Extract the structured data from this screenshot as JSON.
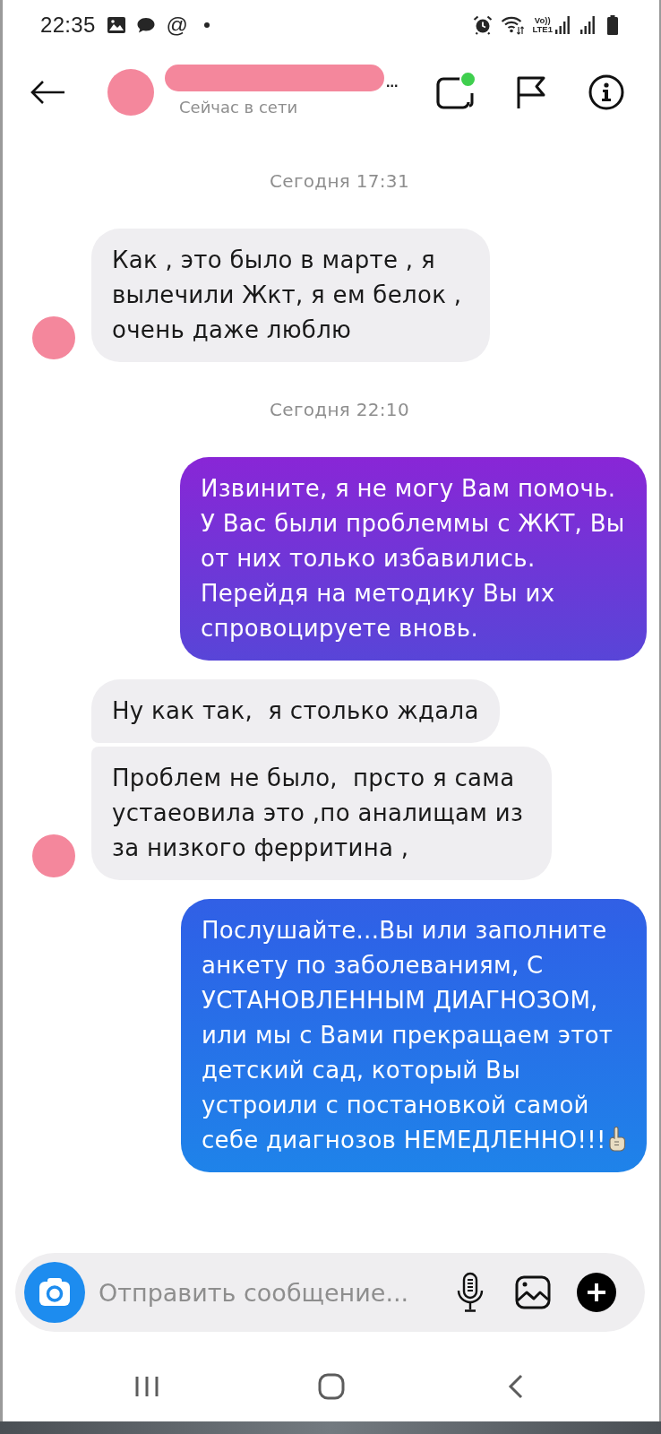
{
  "status_bar": {
    "time": "22:35",
    "notification_glyph": "@",
    "network_label": [
      "Vo))",
      "LTE1"
    ]
  },
  "header": {
    "name_redacted": true,
    "name_tail": "...",
    "status": "Сейчас в сети",
    "call_active": true
  },
  "messages": [
    {
      "kind": "timestamp",
      "text": "Сегодня 17:31"
    },
    {
      "kind": "received",
      "text": "Как , это было в марте , я вылечили Жкт, я ем белок , очень даже люблю",
      "avatar": true
    },
    {
      "kind": "timestamp",
      "text": "Сегодня 22:10"
    },
    {
      "kind": "sent",
      "text": "Извините, я не могу Вам помочь. У Вас были проблеммы с ЖКТ, Вы от них только избавились. Перейдя на методику Вы их спровоцируете вновь."
    },
    {
      "kind": "received",
      "text": "Ну как так,  я столько ждала",
      "avatar": false
    },
    {
      "kind": "received",
      "text": "Проблем не было,  прсто я сама устаеовила это ,по аналищам из за низкого ферритина ,",
      "avatar": true
    },
    {
      "kind": "sent",
      "text": "Послушайте...Вы или заполните анкету по заболеваниям, С УСТАНОВЛЕННЫМ ДИАГНОЗОМ, или мы с Вами прекращаем этот детский сад, который Вы устроили с постановкой самой себе диагнозов НЕМЕДЛЕННО!!!",
      "trailing_emoji": true
    }
  ],
  "composer": {
    "placeholder": "Отправить сообщение..."
  }
}
